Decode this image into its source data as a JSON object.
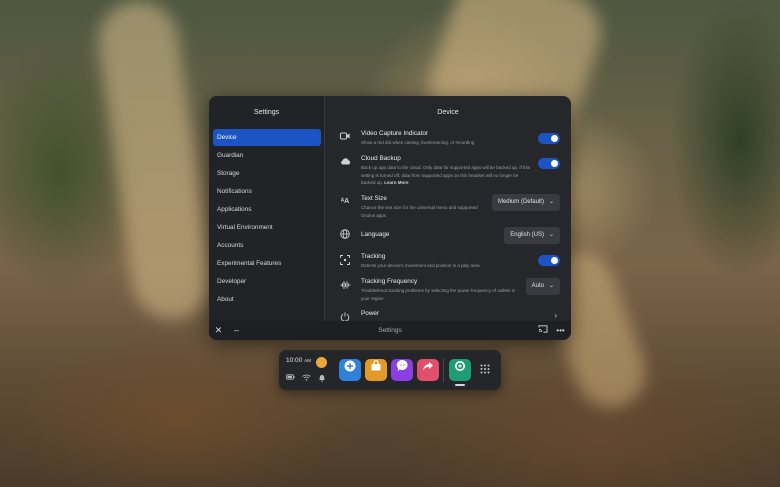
{
  "window": {
    "sidebar_title": "Settings",
    "main_title": "Device",
    "bottom_title": "Settings"
  },
  "sidebar": {
    "items": [
      {
        "label": "Device",
        "active": true
      },
      {
        "label": "Guardian"
      },
      {
        "label": "Storage"
      },
      {
        "label": "Notifications"
      },
      {
        "label": "Applications"
      },
      {
        "label": "Virtual Environment"
      },
      {
        "label": "Accounts"
      },
      {
        "label": "Experimental Features"
      },
      {
        "label": "Developer"
      },
      {
        "label": "About"
      }
    ]
  },
  "settings": {
    "video_capture": {
      "title": "Video Capture Indicator",
      "desc": "Show a red dot when casting, livestreaming, or recording",
      "icon": "video-camera-icon",
      "enabled": true
    },
    "cloud_backup": {
      "title": "Cloud Backup",
      "desc": "Back up app data to the cloud. Only data for supported apps will be backed up. If this setting is turned off, data from supported apps on this headset will no longer be backed up.",
      "learn_more": "Learn More",
      "icon": "cloud-icon",
      "enabled": true
    },
    "text_size": {
      "title": "Text Size",
      "desc": "Chance the text size for the universal menu and supported Oculus apps",
      "icon": "text-size-icon",
      "value": "Medium (Default)"
    },
    "language": {
      "title": "Language",
      "icon": "globe-icon",
      "value": "English (US)"
    },
    "tracking": {
      "title": "Tracking",
      "desc": "Detects your device's movement and position in a play area",
      "icon": "tracking-icon",
      "enabled": true
    },
    "tracking_frequency": {
      "title": "Tracking Frequency",
      "desc": "Troubleshoot tracking problems by selecting the power frequency of outlets in your region",
      "icon": "waveform-icon",
      "value": "Auto"
    },
    "power": {
      "title": "Power",
      "icon": "power-icon"
    }
  },
  "dock": {
    "time": "10:00",
    "ampm": "AM",
    "apps": [
      {
        "name": "explore-app-icon",
        "color": "#2f80d8"
      },
      {
        "name": "store-app-icon",
        "color": "#e09a25"
      },
      {
        "name": "messenger-app-icon",
        "color": "#8b3fe0"
      },
      {
        "name": "share-app-icon",
        "color": "#e0506d"
      },
      {
        "name": "settings-app-icon",
        "color": "#1f9e73"
      }
    ]
  },
  "colors": {
    "accent": "#1c54c6",
    "panel": "#26272b"
  }
}
